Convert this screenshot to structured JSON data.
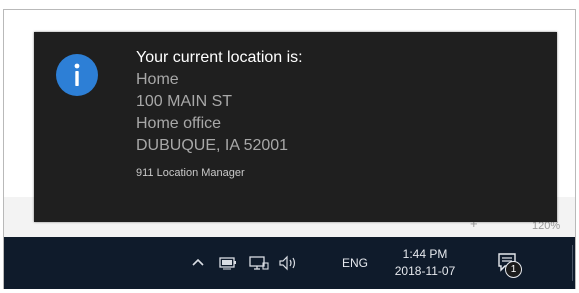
{
  "toast": {
    "icon": "info-icon",
    "accent_color": "#2d7fd6",
    "title": "Your current location is:",
    "lines": [
      "Home",
      "100 MAIN ST",
      "Home office",
      "DUBUQUE, IA 52001"
    ],
    "source": "911 Location Manager"
  },
  "background": {
    "zoom_label": "120%",
    "zoom_plus": "+"
  },
  "taskbar": {
    "icons": [
      "chevron-up-icon",
      "battery-icon",
      "network-icon",
      "volume-icon",
      "action-center-icon"
    ],
    "language": "ENG",
    "time": "1:44 PM",
    "date": "2018-11-07",
    "notification_count": "1"
  }
}
